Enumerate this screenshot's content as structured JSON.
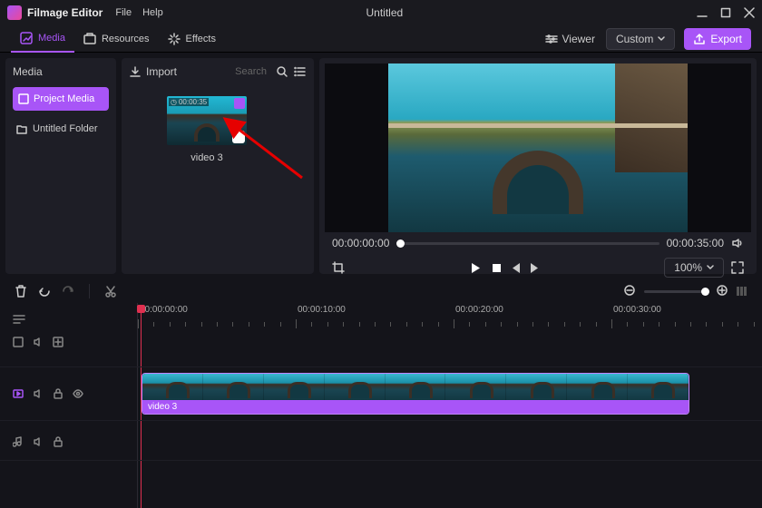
{
  "app": {
    "name": "Filmage Editor",
    "doc_title": "Untitled"
  },
  "title_menu": {
    "file": "File",
    "help": "Help"
  },
  "tabs": {
    "media": "Media",
    "resources": "Resources",
    "effects": "Effects"
  },
  "toolbar": {
    "viewer": "Viewer",
    "custom": "Custom",
    "export": "Export"
  },
  "left_panel": {
    "title": "Media",
    "project_media": "Project Media",
    "folder": "Untitled Folder"
  },
  "media_panel": {
    "import": "Import",
    "search_ph": "Search",
    "thumb": {
      "name": "video 3",
      "duration": "00:00:35"
    }
  },
  "preview": {
    "current_time": "00:00:00:00",
    "total_time": "00:00:35:00",
    "zoom": "100%"
  },
  "timeline": {
    "ruler_labels": [
      "00:00:00:00",
      "00:00:10:00",
      "00:00:20:00",
      "00:00:30:00"
    ],
    "clip_name": "video 3"
  }
}
